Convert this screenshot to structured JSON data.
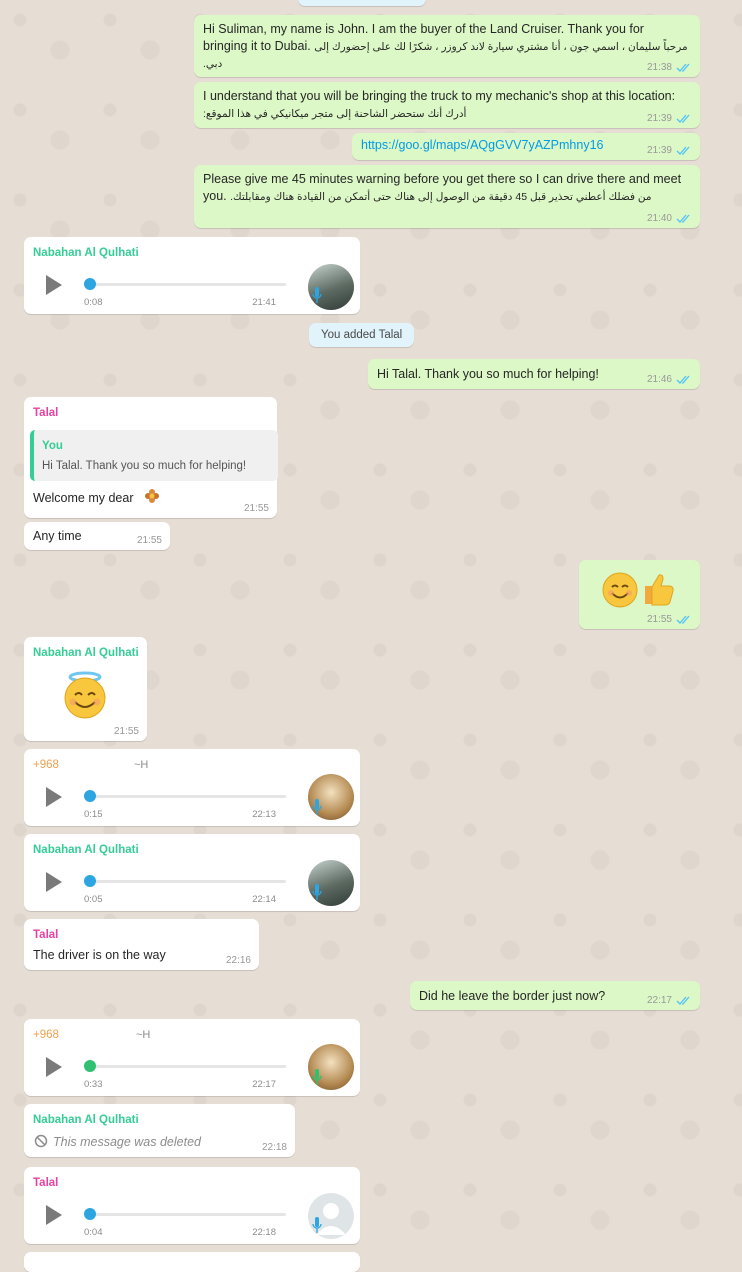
{
  "messages": {
    "m1": {
      "text_en": "Hi Suliman, my name is John.  I am the buyer of the Land Cruiser.  Thank you for bringing it to Dubai.",
      "text_ar": "مرحباً سليمان ، اسمي جون ، أنا مشتري سيارة لاند كروزر ، شكرًا لك على إحضورك إلى دبي.",
      "time": "21:38"
    },
    "m2": {
      "text_en": "I understand that you will be bringing the truck to my mechanic's shop at this location:",
      "text_ar": "أدرك أنك ستحضر الشاحنة إلى متجر ميكانيكي في هذا الموقع:",
      "time": "21:39"
    },
    "m3": {
      "link": "https://goo.gl/maps/AQgGVV7yAZPmhny16",
      "time": "21:39"
    },
    "m4": {
      "text_en": "Please give me 45 minutes warning before you get there so I can drive there and meet you.",
      "text_ar": "من فضلك أعطني تحذير قبل 45 دقيقة من الوصول إلى هناك حتى أتمكن من القيادة هناك ومقابلتك.",
      "time": "21:40"
    },
    "v1": {
      "sender": "Nabahan Al Qulhati",
      "duration": "0:08",
      "time": "21:41"
    },
    "sys1": {
      "text": "You added Talal"
    },
    "m5": {
      "text": "Hi Talal.  Thank you so much for helping!",
      "time": "21:46"
    },
    "m6": {
      "sender": "Talal",
      "quote_sender": "You",
      "quote_text": "Hi Talal.  Thank you so much for helping!",
      "text": "Welcome my dear",
      "time": "21:55"
    },
    "m7": {
      "text": "Any time",
      "time": "21:55"
    },
    "m8": {
      "time": "21:55"
    },
    "m9": {
      "sender": "Nabahan Al Qulhati",
      "time": "21:55"
    },
    "v2": {
      "sender": "+968",
      "sender_suffix": "~H",
      "duration": "0:15",
      "time": "22:13"
    },
    "v3": {
      "sender": "Nabahan Al Qulhati",
      "duration": "0:05",
      "time": "22:14"
    },
    "m10": {
      "sender": "Talal",
      "text": "The driver is on the way",
      "time": "22:16"
    },
    "m11": {
      "text": "Did he leave the border just now?",
      "time": "22:17"
    },
    "v4": {
      "sender": "+968",
      "sender_suffix": "~H",
      "duration": "0:33",
      "time": "22:17"
    },
    "m12": {
      "sender": "Nabahan Al Qulhati",
      "text": "This message was deleted",
      "time": "22:18"
    },
    "v5": {
      "sender": "Talal",
      "duration": "0:04",
      "time": "22:18"
    }
  },
  "colors": {
    "outgoing": "#dcf8c6",
    "incoming": "#ffffff",
    "read_ticks": "#4fc3f7",
    "play_dot_blue": "#2ca5e0",
    "play_dot_green": "#2fc071"
  },
  "icons": [
    "double-check-icon",
    "play-icon",
    "mic-icon",
    "blocked-icon",
    "flower-emoji",
    "smile-emoji",
    "thumbs-up-emoji",
    "halo-smile-emoji"
  ]
}
